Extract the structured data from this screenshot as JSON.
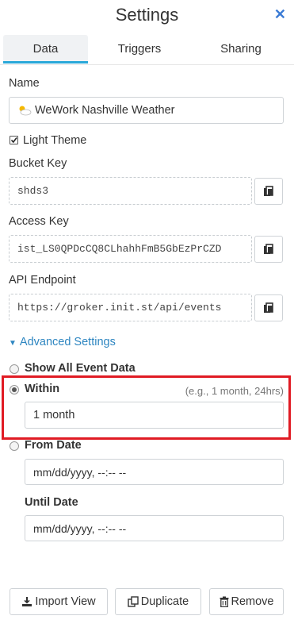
{
  "header": {
    "title": "Settings",
    "close_label": "✕"
  },
  "tabs": [
    {
      "label": "Data",
      "active": true
    },
    {
      "label": "Triggers",
      "active": false
    },
    {
      "label": "Sharing",
      "active": false
    }
  ],
  "form": {
    "name_label": "Name",
    "name_value": "WeWork Nashville Weather",
    "name_icon": "partly-cloudy-icon",
    "light_theme_label": "Light Theme",
    "light_theme_checked": true,
    "bucket_key_label": "Bucket Key",
    "bucket_key_value": "shds3",
    "access_key_label": "Access Key",
    "access_key_value": "ist_LS0QPDcCQ8CLhahhFmB5GbEzPrCZD",
    "api_endpoint_label": "API Endpoint",
    "api_endpoint_value": "https://groker.init.st/api/events"
  },
  "advanced": {
    "toggle_label": "Advanced Settings",
    "show_all_label": "Show All Event Data",
    "within_label": "Within",
    "within_hint": "(e.g., 1 month, 24hrs)",
    "within_value": "1 month",
    "from_date_label": "From Date",
    "from_date_value": "mm/dd/yyyy, --:-- --",
    "until_date_label": "Until Date",
    "until_date_value": "mm/dd/yyyy, --:-- --",
    "selected": "within"
  },
  "actions": {
    "import_label": "Import View",
    "duplicate_label": "Duplicate",
    "remove_label": "Remove"
  },
  "colors": {
    "accent": "#2aa8d9",
    "link": "#2e86c1",
    "highlight": "#e01b24"
  }
}
